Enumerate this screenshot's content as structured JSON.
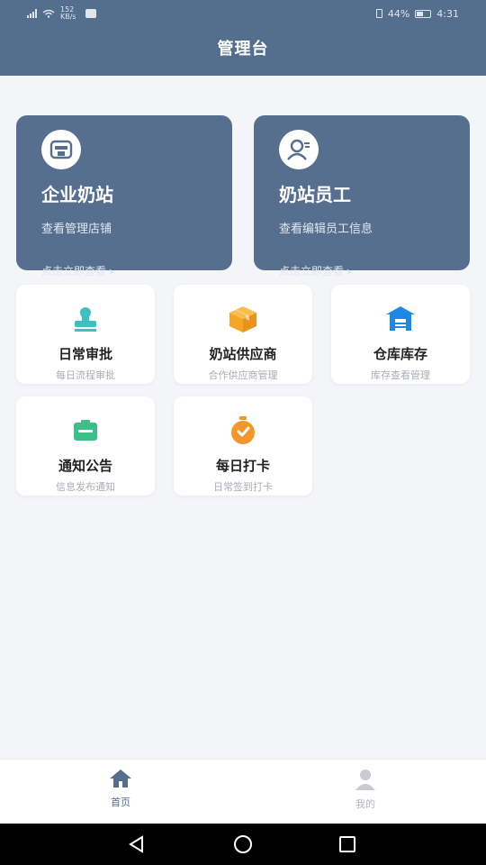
{
  "status_bar": {
    "signal_text": "152 KB/s",
    "battery": "44%",
    "time": "4:31"
  },
  "header": {
    "title": "管理台"
  },
  "cards": [
    {
      "icon": "store-icon",
      "title": "企业奶站",
      "subtitle": "查看管理店铺",
      "cta": "点击立即查看 ▸"
    },
    {
      "icon": "employee-icon",
      "title": "奶站员工",
      "subtitle": "查看编辑员工信息",
      "cta": "点击立即查看 ▸"
    }
  ],
  "tiles": [
    {
      "icon": "approval-icon",
      "name": "日常审批",
      "sub": "每日流程审批",
      "color": "#3cc0c4"
    },
    {
      "icon": "box-icon",
      "name": "奶站供应商",
      "sub": "合作供应商管理",
      "color": "#f5a623"
    },
    {
      "icon": "warehouse-icon",
      "name": "仓库库存",
      "sub": "库存查看管理",
      "color": "#1e88e5"
    },
    {
      "icon": "notice-icon",
      "name": "通知公告",
      "sub": "信息发布通知",
      "color": "#3dbf8a"
    },
    {
      "icon": "clock-in-icon",
      "name": "每日打卡",
      "sub": "日常签到打卡",
      "color": "#f5962a"
    }
  ],
  "tabs": [
    {
      "icon": "home-icon",
      "label": "首页",
      "active": true,
      "color": "#546e8e"
    },
    {
      "icon": "user-icon",
      "label": "我的",
      "active": false,
      "color": "#b0b5bc"
    }
  ],
  "navbar": {
    "icons": [
      "back-icon",
      "home-circle-icon",
      "recents-icon"
    ]
  }
}
